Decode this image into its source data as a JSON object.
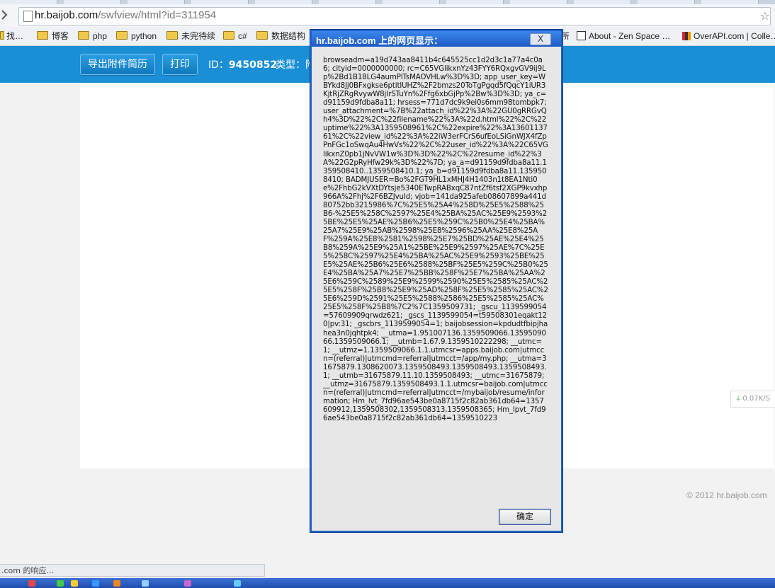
{
  "browser": {
    "url_host": "hr.baijob.com",
    "url_path": "/swfview/html?id=311954"
  },
  "bookmarks": {
    "items": [
      {
        "label": "找…",
        "icon": "folder-icon"
      },
      {
        "label": "博客",
        "icon": "folder-icon"
      },
      {
        "label": "php",
        "icon": "folder-icon"
      },
      {
        "label": "python",
        "icon": "folder-icon"
      },
      {
        "label": "未完待续",
        "icon": "folder-icon"
      },
      {
        "label": "c#",
        "icon": "folder-icon"
      },
      {
        "label": "数据结构",
        "icon": "folder-icon"
      },
      {
        "label": "所",
        "icon": "folder-icon"
      },
      {
        "label": "About - Zen Space …",
        "icon": "page-icon"
      },
      {
        "label": "OverAPI.com | Colle…",
        "icon": "multicolor-icon"
      }
    ]
  },
  "toolbar": {
    "export_label": "导出附件简历",
    "print_label": "打印",
    "id_label": "ID：",
    "id_value": "9450852",
    "type_label": "类型：",
    "type_value": "附"
  },
  "dialog": {
    "title": "hr.baijob.com 上的网页显示：",
    "close_label": "X",
    "message": "browseadm=a19d743aa8411b4c645525cc1d2d3c1a77a4c0a6; cityid=0000000000; rc=C65VGlikxnYz43FYY6RQxgvGV9ij9Lp%2Bd1B18LG4aumPlTsMAOVHLw%3D%3D; app_user_key=WBYkd8Jj0BFxgkse6ptitlUHZ%2F2bmzs20ToTgPgqd5fQqcY1iUR3KjtRjZRgRvywW8jIrSTuYn%2Ffg6xbGjPp%2Bw%3D%3D; ya_c=d91159d9fdba8a11; hrsess=771d7dc9k9ei0s6mm98tombpk7; user_attachment=%7B%22attach_id%22%3A%22GU0gRRGvQh4%3D%22%2C%22filename%22%3A%22d.html%22%2C%22uptime%22%3A1359508961%2C%22expire%22%3A1360113761%2C%22view_id%22%3A%22iW3erFCrS6ufEoLSiGnWJX4fZpPnFGc1oSwqAu4HwVs%22%2C%22user_id%22%3A%22C65VGlikxnZ0pb1jNvVW1w%3D%3D%22%2C%22resume_id%22%3A%22G2pRyHfw29k%3D%22%7D; ya_a=d91159d9fdba8a11.1359508410..1359508410.1; ya_b=d91159d9fdba8a11.1359508410; BADMJUSER=Bo%2FGT9HL1xMHJ4H1403n1t8EA1Nti0e%2FhbG2kVXtDYtsje5340ETwpRABxqC87ntZf6tsf2XGP9kvxhp966A%2Fhj%2F6BZJvuId; vjob=141da925afeb08607899a441d80752bb3215986%7C%25E5%25A4%258D%25E5%2588%25B6-%25E5%258C%2597%25E4%25BA%25AC%25E9%2593%25BE%25E5%25AE%25B6%25E5%259C%25B0%25E4%25BA%25A7%25E9%25AB%2598%25E8%2596%25AA%25E8%25AF%259A%25E8%2581%2598%25E7%25BD%25AE%25E4%25B8%259A%25E9%25A1%25BE%25E9%2597%25AE%7C%25E5%258C%2597%25E4%25BA%25AC%25E9%2593%25BE%25E5%25AE%25B6%25E6%2588%25BF%25E5%259C%25B0%25E4%25BA%25A7%25E7%25BB%258F%25E7%25BA%25AA%25E6%259C%2589%25E9%2599%2590%25E5%2585%25AC%25E5%258F%25B8%25E9%25AD%258F%25E5%2585%25AC%25E6%259D%2591%25E5%2588%2586%25E5%2585%25AC%25E5%258F%25B8%7C2%7C1359509731; _gscu_1139599054=57609909qrwdz621; _gscs_1139599054=t59508301eqakt120|pv:31; _gscbrs_1139599054=1; baijobsession=kpdudtfbipjhahea3n0jqhtpk4; __utma=1.951007136.1359509066.1359509066.1359509066.1; __utmb=1.67.9.1359510222298; __utmc=1; __utmz=1.1359509066.1.1.utmcsr=apps.baijob.com|utmccn=(referral)|utmcmd=referral|utmcct=/app/my.php; __utma=31675879.1308620073.1359508493.1359508493.1359508493.1; __utmb=31675879.11.10.1359508493; __utmc=31675879; __utmz=31675879.1359508493.1.1.utmcsr=baijob.com|utmccn=(referral)|utmcmd=referral|utmcct=/mybaijob/resume/information; Hm_lvt_7fd96ae543be0a8715f2c82ab361db64=1357609912,1359508302,1359508313,1359508365; Hm_lpvt_7fd96ae543be0a8715f2c82ab361db64=1359510223",
    "ok_label": "确定"
  },
  "speed": {
    "value": "0.07K/S"
  },
  "footer": {
    "copyright": "© 2012 hr.baijob.com"
  },
  "status": {
    "text": ".com 的响应..."
  }
}
